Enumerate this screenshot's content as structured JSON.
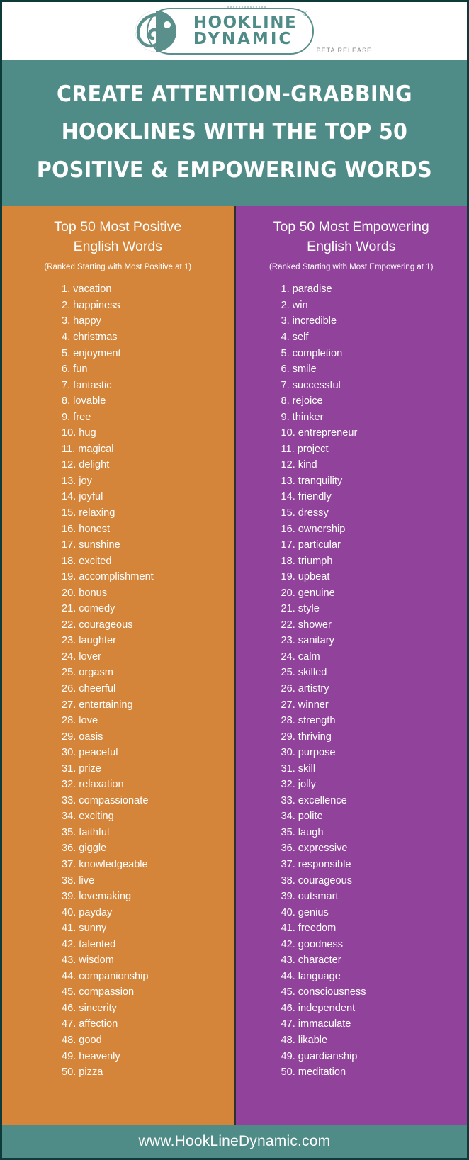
{
  "brand": {
    "logo_line1": "HOOKLINE",
    "logo_line2": "DYNAMIC",
    "registered_mark": "®",
    "beta_label": "BETA RELEASE",
    "logo_icon": "hook-swirl-icon"
  },
  "headline": {
    "line1": "CREATE ATTENTION-GRABBING",
    "line2": "HOOKLINES WITH THE TOP 50",
    "line3": "POSITIVE & EMPOWERING WORDS"
  },
  "columns": [
    {
      "id": "positive",
      "title": "Top 50 Most Positive English Words",
      "title_line1": "Top 50 Most Positive",
      "title_line2": "English Words",
      "subtitle": "(Ranked Starting with Most Positive at 1)",
      "background_color": "#d4853a",
      "words": [
        "vacation",
        "happiness",
        "happy",
        "christmas",
        "enjoyment",
        "fun",
        "fantastic",
        "lovable",
        "free",
        "hug",
        "magical",
        "delight",
        "joy",
        "joyful",
        "relaxing",
        "honest",
        "sunshine",
        "excited",
        "accomplishment",
        "bonus",
        "comedy",
        "courageous",
        "laughter",
        "lover",
        "orgasm",
        "cheerful",
        "entertaining",
        "love",
        "oasis",
        "peaceful",
        "prize",
        "relaxation",
        "compassionate",
        "exciting",
        "faithful",
        "giggle",
        "knowledgeable",
        "live",
        "lovemaking",
        "payday",
        "sunny",
        "talented",
        "wisdom",
        "companionship",
        "compassion",
        "sincerity",
        "affection",
        "good",
        "heavenly",
        "pizza"
      ]
    },
    {
      "id": "empowering",
      "title": "Top 50 Most Empowering English Words",
      "title_line1": "Top 50 Most Empowering",
      "title_line2": "English Words",
      "subtitle": "(Ranked Starting with Most Empowering at 1)",
      "background_color": "#91429a",
      "words": [
        "paradise",
        "win",
        "incredible",
        "self",
        "completion",
        "smile",
        "successful",
        "rejoice",
        "thinker",
        "entrepreneur",
        "project",
        "kind",
        "tranquility",
        "friendly",
        "dressy",
        "ownership",
        "particular",
        "triumph",
        "upbeat",
        "genuine",
        "style",
        "shower",
        "sanitary",
        "calm",
        "skilled",
        "artistry",
        "winner",
        "strength",
        "thriving",
        "purpose",
        "skill",
        "jolly",
        "excellence",
        "polite",
        "laugh",
        "expressive",
        "responsible",
        "courageous",
        "outsmart",
        "genius",
        "freedom",
        "goodness",
        "character",
        "language",
        "consciousness",
        "independent",
        "immaculate",
        "likable",
        "guardianship",
        "meditation"
      ]
    }
  ],
  "footer": {
    "url": "www.HookLineDynamic.com"
  },
  "theme": {
    "teal": "#4f8c88",
    "border_dark": "#0d3b3a",
    "orange": "#d4853a",
    "purple": "#91429a",
    "divider": "#2f2f2f",
    "text_white": "#ffffff"
  }
}
